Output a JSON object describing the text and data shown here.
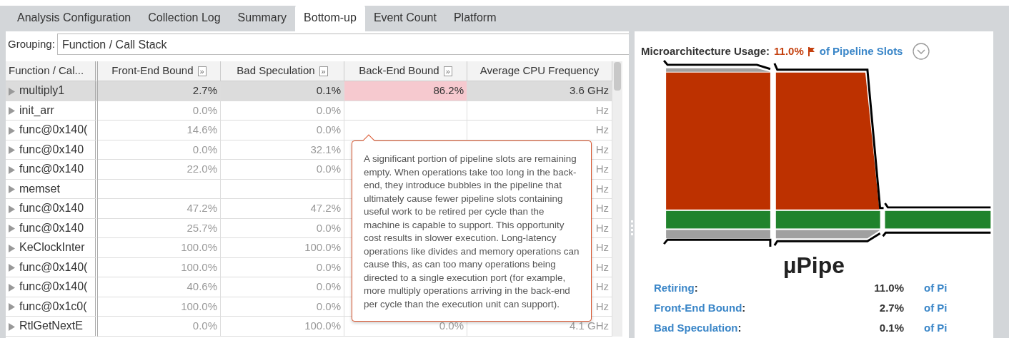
{
  "tabs": [
    {
      "label": "Analysis Configuration",
      "selected": false
    },
    {
      "label": "Collection Log",
      "selected": false
    },
    {
      "label": "Summary",
      "selected": false
    },
    {
      "label": "Bottom-up",
      "selected": true
    },
    {
      "label": "Event Count",
      "selected": false
    },
    {
      "label": "Platform",
      "selected": false
    }
  ],
  "grouping": {
    "label": "Grouping:",
    "value": "Function / Call Stack"
  },
  "table": {
    "columns": [
      {
        "label": "Function / Cal..."
      },
      {
        "label": "Front-End Bound",
        "button": "»"
      },
      {
        "label": "Bad Speculation",
        "button": "»"
      },
      {
        "label": "Back-End Bound",
        "button": "»"
      },
      {
        "label": "Average CPU Frequency"
      }
    ],
    "rows": [
      {
        "name": "multiply1",
        "selected": true,
        "cells": [
          {
            "text": "2.7%",
            "flagged": false
          },
          {
            "text": "0.1%",
            "flagged": false
          },
          {
            "text": "86.2%",
            "flagged": true
          },
          {
            "text": "3.6 GHz",
            "flagged": false
          }
        ]
      },
      {
        "name": "init_arr",
        "selected": false,
        "cells": [
          {
            "text": "0.0%",
            "flagged": false
          },
          {
            "text": "0.0%",
            "flagged": false
          },
          {
            "flagged": false
          },
          {
            "text": "Hz",
            "flagged": false
          }
        ]
      },
      {
        "name": "func@0x140(",
        "selected": false,
        "cells": [
          {
            "text": "14.6%",
            "flagged": false
          },
          {
            "text": "0.0%",
            "flagged": false
          },
          {
            "flagged": false
          },
          {
            "text": "Hz",
            "flagged": false
          }
        ]
      },
      {
        "name": "func@0x140",
        "selected": false,
        "cells": [
          {
            "text": "0.0%",
            "flagged": false
          },
          {
            "text": "32.1%",
            "flagged": false
          },
          {
            "flagged": false
          },
          {
            "text": "Hz",
            "flagged": false
          }
        ]
      },
      {
        "name": "func@0x140",
        "selected": false,
        "cells": [
          {
            "text": "22.0%",
            "flagged": false
          },
          {
            "text": "0.0%",
            "flagged": false
          },
          {
            "flagged": false
          },
          {
            "text": "Hz",
            "flagged": false
          }
        ]
      },
      {
        "name": "memset",
        "selected": false,
        "cells": [
          {
            "flagged": false
          },
          {
            "flagged": false
          },
          {
            "flagged": false
          },
          {
            "text": "Hz",
            "flagged": false
          }
        ]
      },
      {
        "name": "func@0x140",
        "selected": false,
        "cells": [
          {
            "text": "47.2%",
            "flagged": false
          },
          {
            "text": "47.2%",
            "flagged": false
          },
          {
            "flagged": false
          },
          {
            "text": "Hz",
            "flagged": false
          }
        ]
      },
      {
        "name": "func@0x140",
        "selected": false,
        "cells": [
          {
            "text": "25.7%",
            "flagged": false
          },
          {
            "text": "0.0%",
            "flagged": false
          },
          {
            "flagged": false
          },
          {
            "text": "Hz",
            "flagged": false
          }
        ]
      },
      {
        "name": "KeClockInter",
        "selected": false,
        "cells": [
          {
            "text": "100.0%",
            "flagged": false
          },
          {
            "text": "100.0%",
            "flagged": false
          },
          {
            "flagged": false
          },
          {
            "text": "Hz",
            "flagged": false
          }
        ]
      },
      {
        "name": "func@0x140(",
        "selected": false,
        "cells": [
          {
            "text": "100.0%",
            "flagged": false
          },
          {
            "text": "0.0%",
            "flagged": false
          },
          {
            "flagged": false
          },
          {
            "text": "Hz",
            "flagged": false
          }
        ]
      },
      {
        "name": "func@0x140(",
        "selected": false,
        "cells": [
          {
            "text": "40.6%",
            "flagged": false
          },
          {
            "text": "0.0%",
            "flagged": false
          },
          {
            "flagged": false
          },
          {
            "text": "Hz",
            "flagged": false
          }
        ]
      },
      {
        "name": "func@0x1c0(",
        "selected": false,
        "cells": [
          {
            "text": "100.0%",
            "flagged": false
          },
          {
            "text": "0.0%",
            "flagged": false
          },
          {
            "flagged": false
          },
          {
            "text": "Hz",
            "flagged": false
          }
        ]
      },
      {
        "name": "RtlGetNextE",
        "selected": false,
        "cells": [
          {
            "text": "0.0%",
            "flagged": false
          },
          {
            "text": "100.0%",
            "flagged": false
          },
          {
            "text": "0.0%",
            "flagged": false
          },
          {
            "text": "4.1 GHz",
            "flagged": false
          }
        ]
      }
    ]
  },
  "tooltip": {
    "text": "A significant portion of pipeline slots are remaining empty. When operations take too long in the back-end, they introduce bubbles in the pipeline that ultimately cause fewer pipeline slots containing useful work to be retired per cycle than the machine is capable to support. This opportunity cost results in slower execution. Long-latency operations like divides and memory operations can cause this, as can too many operations being directed to a single execution port (for example, more multiply operations arriving in the back-end per cycle than the execution unit can support)."
  },
  "summary": {
    "label": "Microarchitecture Usage:",
    "value": "11.0%",
    "flagged": true,
    "link": "of Pipeline Slots",
    "diagram_title": "µPipe",
    "metrics": [
      {
        "label": "Retiring",
        "colon": ":",
        "value": "11.0%",
        "unit": "of Pi"
      },
      {
        "label": "Front-End Bound",
        "colon": ":",
        "value": "2.7%",
        "unit": "of Pi"
      },
      {
        "label": "Bad Speculation",
        "colon": ":",
        "value": "0.1%",
        "unit": "of Pi"
      }
    ]
  }
}
